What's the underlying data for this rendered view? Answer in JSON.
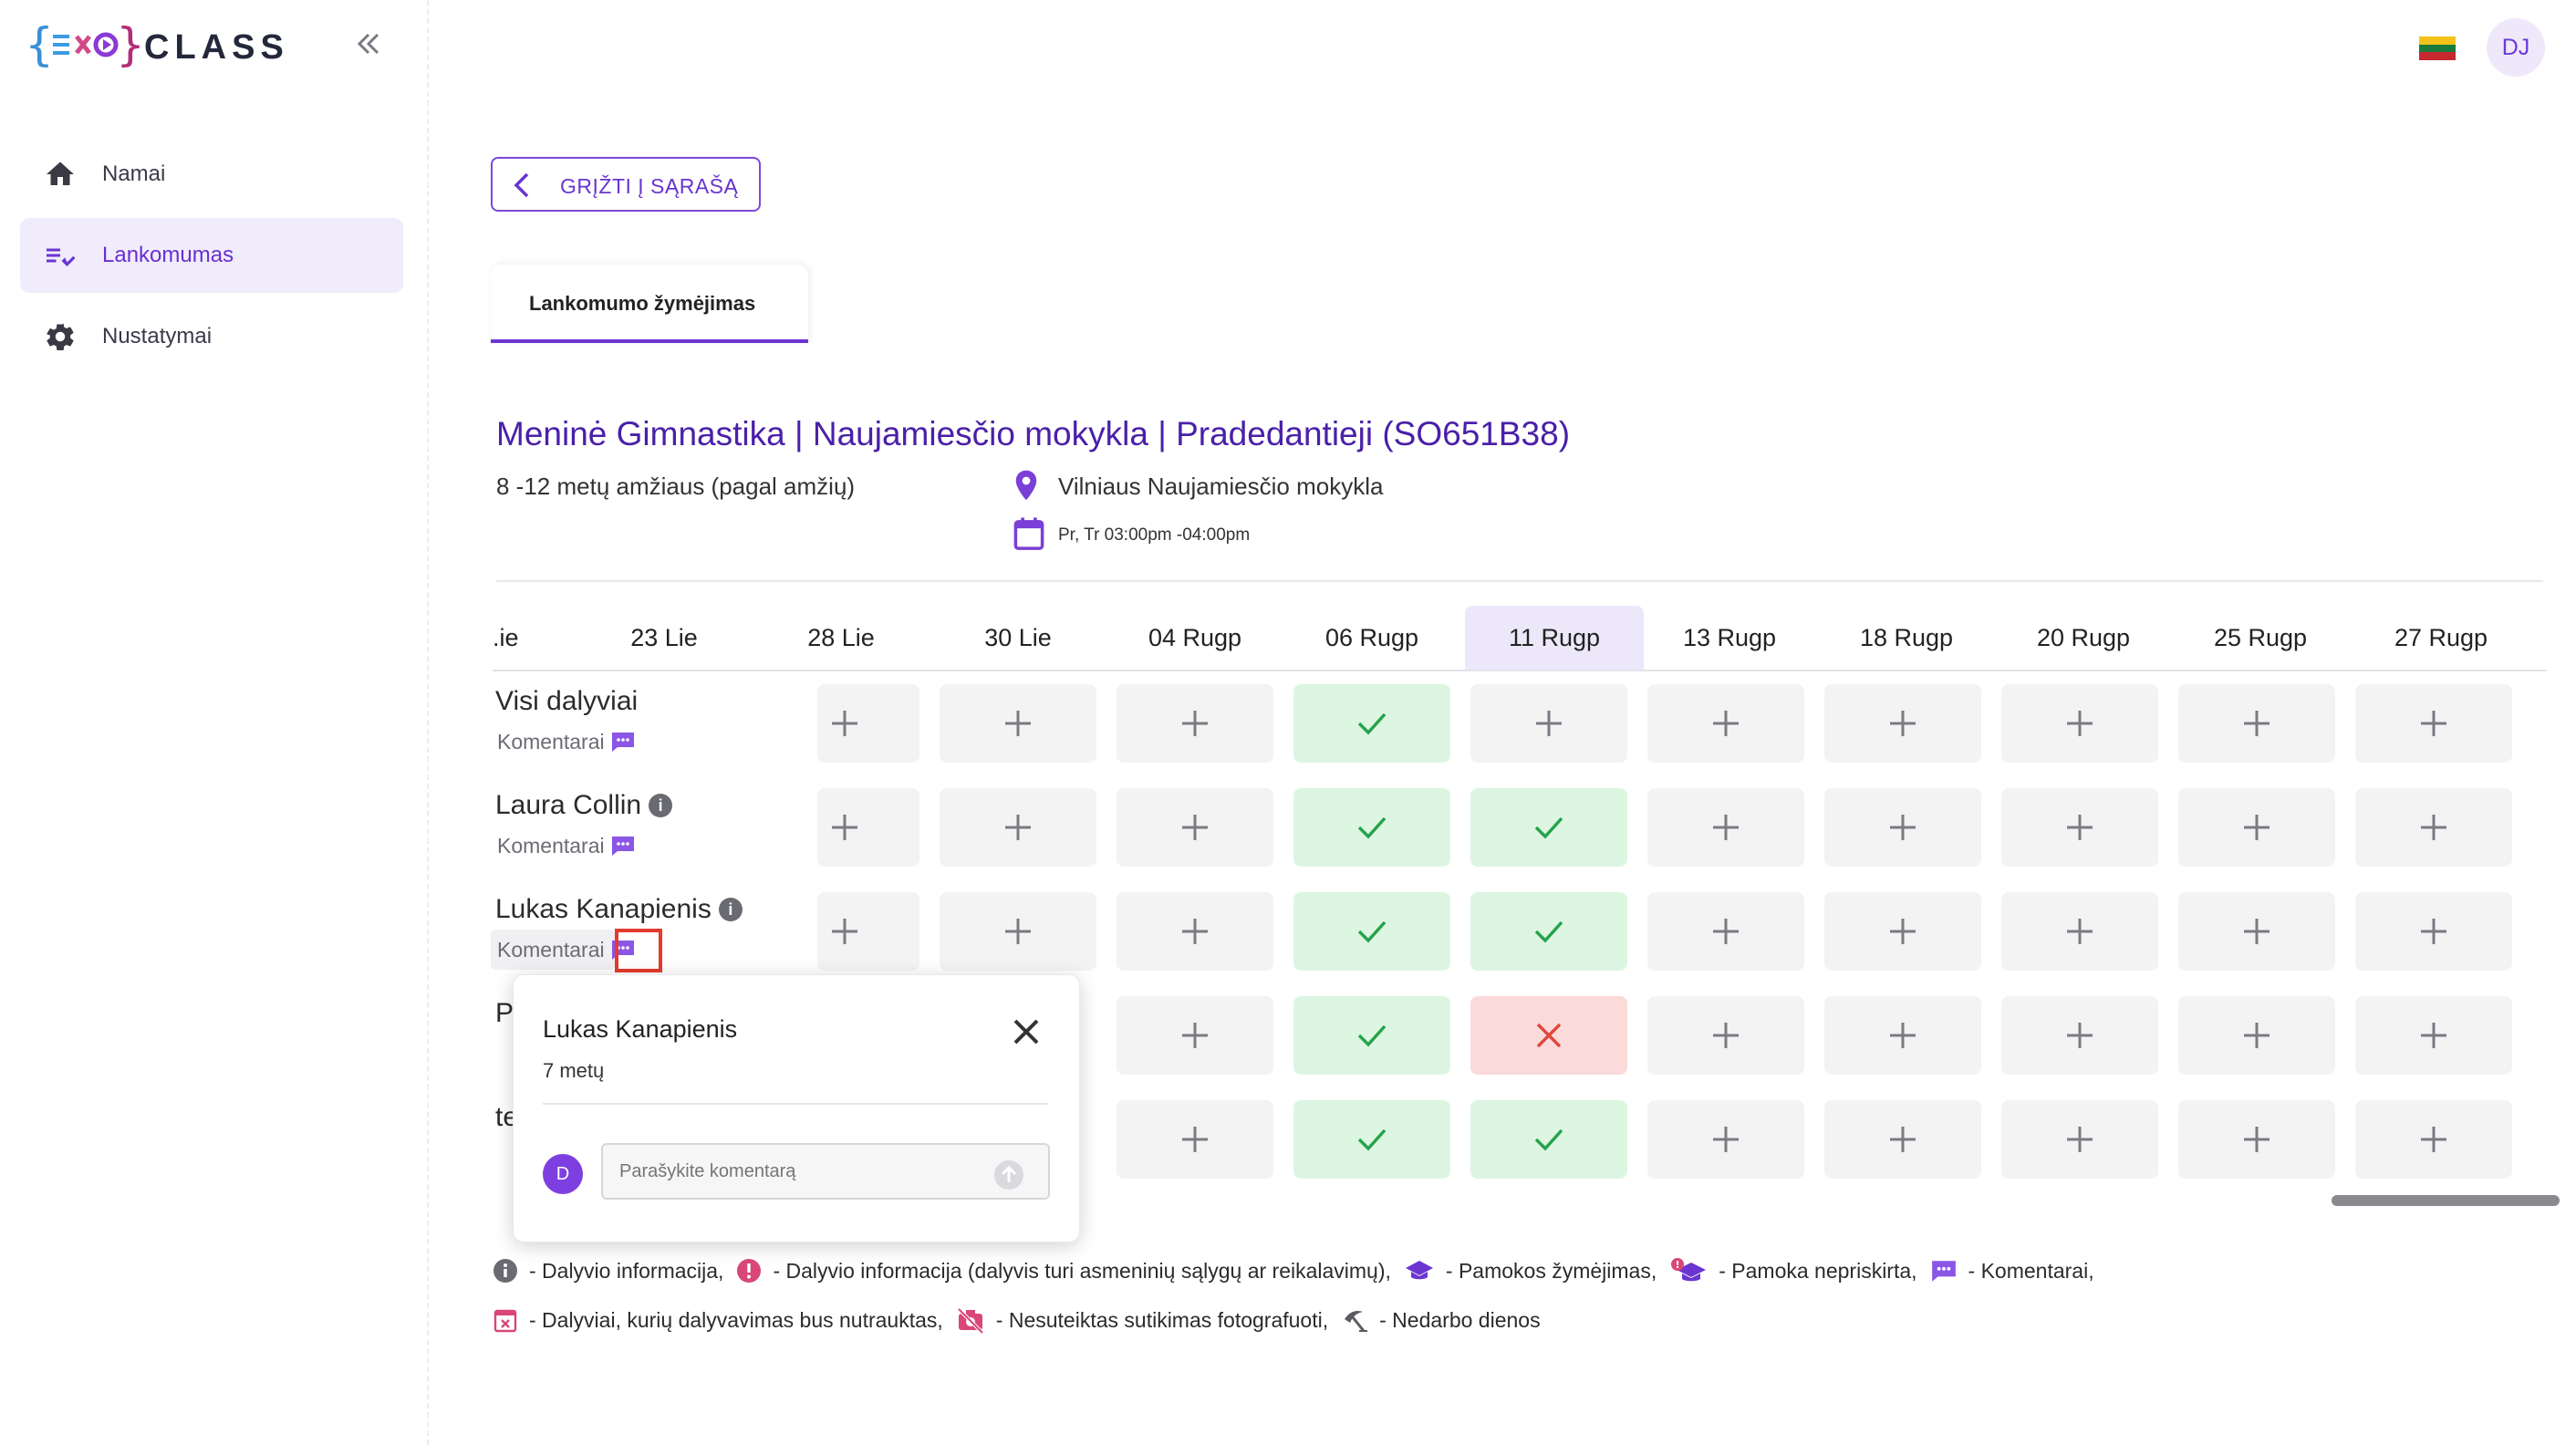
{
  "app": {
    "brand": "CLASS",
    "logo_marks": "{EXO}"
  },
  "sidebar": {
    "items": [
      {
        "label": "Namai",
        "icon": "home-icon",
        "active": false
      },
      {
        "label": "Lankomumas",
        "icon": "checklist-icon",
        "active": true
      },
      {
        "label": "Nustatymai",
        "icon": "gear-icon",
        "active": false
      }
    ]
  },
  "header": {
    "user_initials": "DJ",
    "language_flag": "lithuania-flag"
  },
  "back_button": {
    "label": "GRĮŽTI Į SĄRAŠĄ"
  },
  "tabs": [
    {
      "label": "Lankomumo žymėjimas",
      "active": true
    }
  ],
  "group": {
    "title": "Meninė Gimnastika | Naujamiesčio mokykla | Pradedantieji (SO651B38)",
    "age_range": "8 -12 metų amžiaus (pagal amžių)",
    "location": "Vilniaus Naujamiesčio mokykla",
    "schedule": "Pr, Tr 03:00pm -04:00pm"
  },
  "attendance": {
    "dates": [
      ".ie",
      "23 Lie",
      "28 Lie",
      "30 Lie",
      "04 Rugp",
      "06 Rugp",
      "11 Rugp",
      "13 Rugp",
      "18 Rugp",
      "20 Rugp",
      "25 Rugp",
      "27 Rugp"
    ],
    "highlighted_date": "11 Rugp",
    "comments_label": "Komentarai",
    "rows": [
      {
        "name": "Visi dalyviai",
        "info": false,
        "marks": [
          "add",
          "add",
          "add",
          "present",
          "add",
          "add",
          "add",
          "add",
          "add",
          "add"
        ]
      },
      {
        "name": "Laura Collin",
        "info": true,
        "marks": [
          "add",
          "add",
          "add",
          "present",
          "present",
          "add",
          "add",
          "add",
          "add",
          "add"
        ]
      },
      {
        "name": "Lukas Kanapienis",
        "info": true,
        "marks": [
          "add",
          "add",
          "add",
          "present",
          "present",
          "add",
          "add",
          "add",
          "add",
          "add"
        ]
      },
      {
        "name": "P",
        "info": false,
        "marks": [
          "add",
          "add",
          "add",
          "present",
          "absent",
          "add",
          "add",
          "add",
          "add",
          "add"
        ]
      },
      {
        "name": "te",
        "info": false,
        "marks": [
          "add",
          "add",
          "add",
          "present",
          "present",
          "add",
          "add",
          "add",
          "add",
          "add"
        ]
      }
    ]
  },
  "comment_popup": {
    "name": "Lukas Kanapienis",
    "age": "7 metų",
    "avatar_initial": "D",
    "input_placeholder": "Parašykite komentarą"
  },
  "legend": [
    {
      "icon": "info-icon",
      "text": "- Dalyvio informacija,"
    },
    {
      "icon": "alert-icon",
      "text": "- Dalyvio informacija (dalyvis turi asmeninių sąlygų ar reikalavimų),"
    },
    {
      "icon": "graduation-cap-icon",
      "text": "- Pamokos žymėjimas,"
    },
    {
      "icon": "cap-unassigned-icon",
      "text": "- Pamoka nepriskirta,"
    },
    {
      "icon": "comment-icon",
      "text": "- Komentarai,"
    },
    {
      "icon": "calendar-x-icon",
      "text": "- Dalyviai, kurių dalyvavimas bus nutrauktas,"
    },
    {
      "icon": "no-photo-icon",
      "text": "- Nesuteiktas sutikimas fotografuoti,"
    },
    {
      "icon": "beach-umbrella-icon",
      "text": "- Nedarbo dienos"
    }
  ],
  "colors": {
    "accent": "#6a35d0",
    "title": "#4a20a8",
    "present_bg": "#dcf6e2",
    "present_mark": "#27a24a",
    "absent_bg": "#fbdada",
    "absent_mark": "#e0463c",
    "highlight_outline": "#e53a2e"
  }
}
